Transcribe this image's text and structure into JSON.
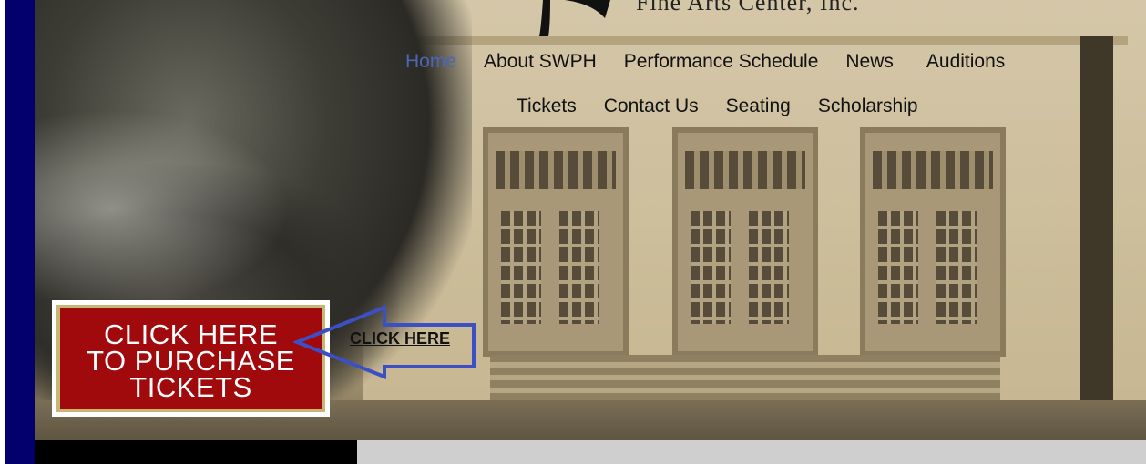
{
  "brand": {
    "logo_text": "Fine Arts Center, Inc."
  },
  "nav": {
    "row1": [
      "Home",
      "About SWPH",
      "Performance Schedule",
      "News",
      "Auditions"
    ],
    "row2": [
      "Tickets",
      "Contact Us",
      "Seating",
      "Scholarship"
    ],
    "active": "Home"
  },
  "ticket_banner": {
    "line1": "CLICK HERE",
    "line2": "TO PURCHASE",
    "line3": "TICKETS"
  },
  "click_here_link": "CLICK HERE",
  "colors": {
    "sidebar": "#03006e",
    "nav_active": "#4a67b5",
    "banner_red": "#a00a0c",
    "banner_gold": "#c8b774",
    "arrow_blue": "#3d4fc4"
  }
}
